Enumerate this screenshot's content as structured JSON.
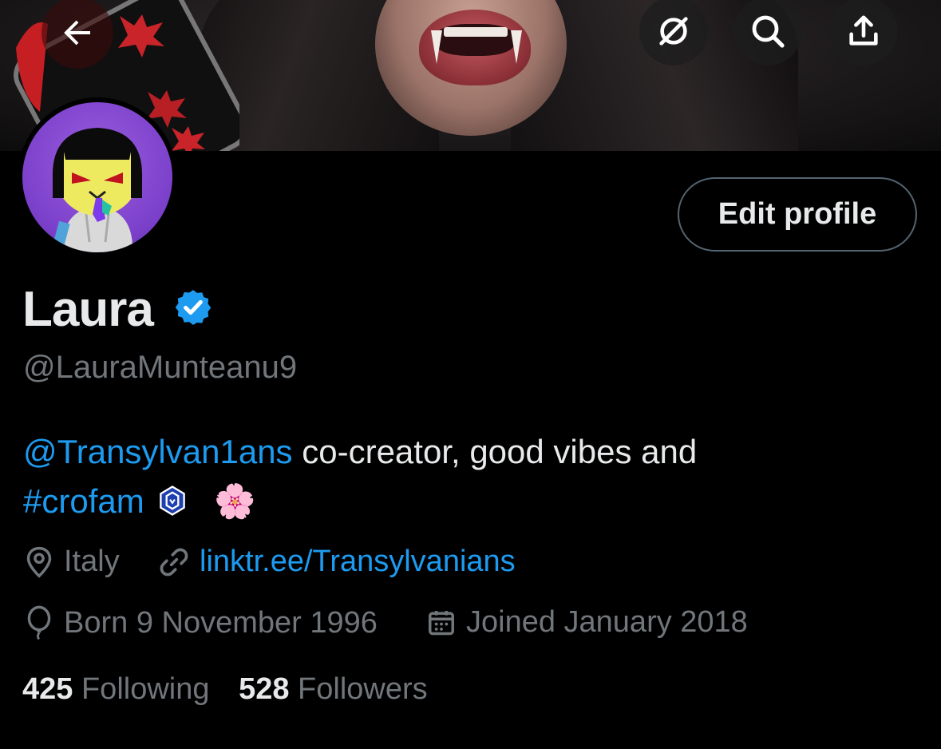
{
  "header": {
    "back_icon": "arrow-left-icon",
    "actions": [
      "grok-icon",
      "search-icon",
      "share-icon"
    ]
  },
  "profile": {
    "edit_label": "Edit profile",
    "name": "Laura",
    "handle": "@LauraMunteanu9",
    "bio": {
      "mention": "@Transylvan1ans",
      "text": " co-creator, good vibes and",
      "hashtag": "#crofam",
      "emoji": "🌸"
    },
    "location": "Italy",
    "website": "linktr.ee/Transylvanians",
    "birthday": "Born 9 November 1996",
    "joined": "Joined January 2018",
    "following_count": "425",
    "following_label": "Following",
    "followers_count": "528",
    "followers_label": "Followers"
  },
  "colors": {
    "accent": "#1d9bf0",
    "muted": "#71767b",
    "text": "#e7e9ea",
    "background": "#000000"
  }
}
